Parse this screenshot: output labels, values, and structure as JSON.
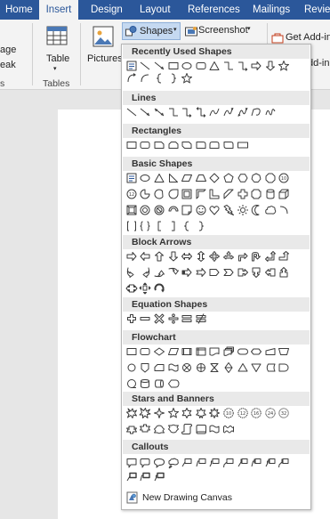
{
  "tabs": [
    {
      "name": "home",
      "label": "Home",
      "active": false
    },
    {
      "name": "insert",
      "label": "Insert",
      "active": true
    },
    {
      "name": "design",
      "label": "Design",
      "active": false
    },
    {
      "name": "layout",
      "label": "Layout",
      "active": false
    },
    {
      "name": "references",
      "label": "References",
      "active": false
    },
    {
      "name": "mailings",
      "label": "Mailings",
      "active": false
    },
    {
      "name": "review",
      "label": "Revie",
      "active": false
    }
  ],
  "ribbon": {
    "page_fragment": "age",
    "break_fragment": "eak",
    "s_fragment": "s",
    "table_label": "Table",
    "tables_group": "Tables",
    "pictures_label": "Pictures",
    "shapes_label": "Shapes",
    "screenshot_label": "Screenshot",
    "get_addins_label": "Get Add-in",
    "addins_fragment": "dd-in"
  },
  "shapes_panel": {
    "sections": [
      {
        "title": "Recently Used Shapes",
        "rows": [
          [
            "textbox",
            "line",
            "arrow-line",
            "rectangle",
            "oval",
            "rounded-rect",
            "triangle",
            "elbow-connector",
            "elbow-arrow",
            "right-arrow",
            "down-arrow",
            "star5"
          ],
          [
            "curved-arrow",
            "arc-up",
            "brace-left",
            "brace-right",
            "star-outline"
          ]
        ]
      },
      {
        "title": "Lines",
        "rows": [
          [
            "line",
            "arrow-line",
            "double-arrow",
            "elbow",
            "elbow-arrow",
            "elbow-double",
            "curve",
            "curve-arrow",
            "curve-double",
            "freeform",
            "scribble"
          ]
        ]
      },
      {
        "title": "Rectangles",
        "rows": [
          [
            "rectangle",
            "rounded-rect",
            "snip-corner",
            "snip-same",
            "snip-diag",
            "round-corner",
            "round-same",
            "round-diag",
            "rect-flat"
          ]
        ]
      },
      {
        "title": "Basic Shapes",
        "rows": [
          [
            "textbox",
            "oval",
            "triangle",
            "right-triangle",
            "parallelogram",
            "trapezoid",
            "diamond",
            "pentagon",
            "hexagon",
            "heptagon",
            "octagon",
            "decagon"
          ],
          [
            "dodecagon",
            "pie",
            "chord",
            "teardrop",
            "frame",
            "half-frame",
            "l-shape",
            "diag-stripe",
            "cross",
            "plaque",
            "can",
            "cube"
          ],
          [
            "bevel",
            "donut",
            "no-symbol",
            "block-arc",
            "folded-corner",
            "smiley",
            "heart",
            "lightning",
            "sun",
            "moon",
            "cloud",
            "arc"
          ],
          [
            "bracket-pair",
            "brace-pair",
            "left-bracket",
            "right-bracket",
            "left-brace",
            "right-brace"
          ]
        ]
      },
      {
        "title": "Block Arrows",
        "rows": [
          [
            "right-arrow",
            "left-arrow",
            "up-arrow",
            "down-arrow",
            "left-right-arrow",
            "up-down-arrow",
            "quad-arrow",
            "left-right-up",
            "bent-arrow",
            "u-turn",
            "left-up-arrow",
            "bent-up-arrow"
          ],
          [
            "curved-right",
            "curved-left",
            "curved-up",
            "curved-down",
            "striped-right",
            "notched-right",
            "pentagon-arrow",
            "chevron",
            "right-callout",
            "down-callout",
            "left-callout",
            "up-callout"
          ],
          [
            "left-right-callout",
            "quad-callout",
            "circular-arrow"
          ]
        ]
      },
      {
        "title": "Equation Shapes",
        "rows": [
          [
            "plus",
            "minus",
            "multiply",
            "divide",
            "equal",
            "not-equal"
          ]
        ]
      },
      {
        "title": "Flowchart",
        "rows": [
          [
            "process",
            "alt-process",
            "decision",
            "data",
            "predefined",
            "internal-storage",
            "document",
            "multidocument",
            "terminator",
            "preparation",
            "manual-input",
            "manual-operation"
          ],
          [
            "connector",
            "offpage",
            "card",
            "punched-tape",
            "summing-junction",
            "or",
            "collate",
            "sort",
            "extract",
            "merge",
            "stored-data",
            "delay"
          ],
          [
            "sequential-access",
            "magnetic-disk",
            "direct-access",
            "display"
          ]
        ]
      },
      {
        "title": "Stars and Banners",
        "rows": [
          [
            "explosion1",
            "explosion2",
            "star4",
            "star5",
            "star6",
            "star7",
            "star8",
            "star10",
            "star12",
            "star16",
            "star24",
            "star32"
          ],
          [
            "ribbon-up",
            "ribbon-down",
            "curved-ribbon-up",
            "curved-ribbon-down",
            "vertical-scroll",
            "horizontal-scroll",
            "wave",
            "double-wave"
          ]
        ]
      },
      {
        "title": "Callouts",
        "rows": [
          [
            "rect-callout",
            "rounded-callout",
            "oval-callout",
            "cloud-callout",
            "line-callout1",
            "line-callout2",
            "line-callout3",
            "line-callout4",
            "accent-callout1",
            "accent-callout2",
            "accent-callout3",
            "accent-callout4"
          ],
          [
            "border-callout1",
            "border-callout2",
            "border-callout3"
          ]
        ]
      }
    ],
    "new_canvas_label": "New Drawing Canvas"
  },
  "colors": {
    "ribbon_blue": "#2b579a",
    "icon_stroke": "#3c3c3c",
    "accent": "#2b579a"
  }
}
